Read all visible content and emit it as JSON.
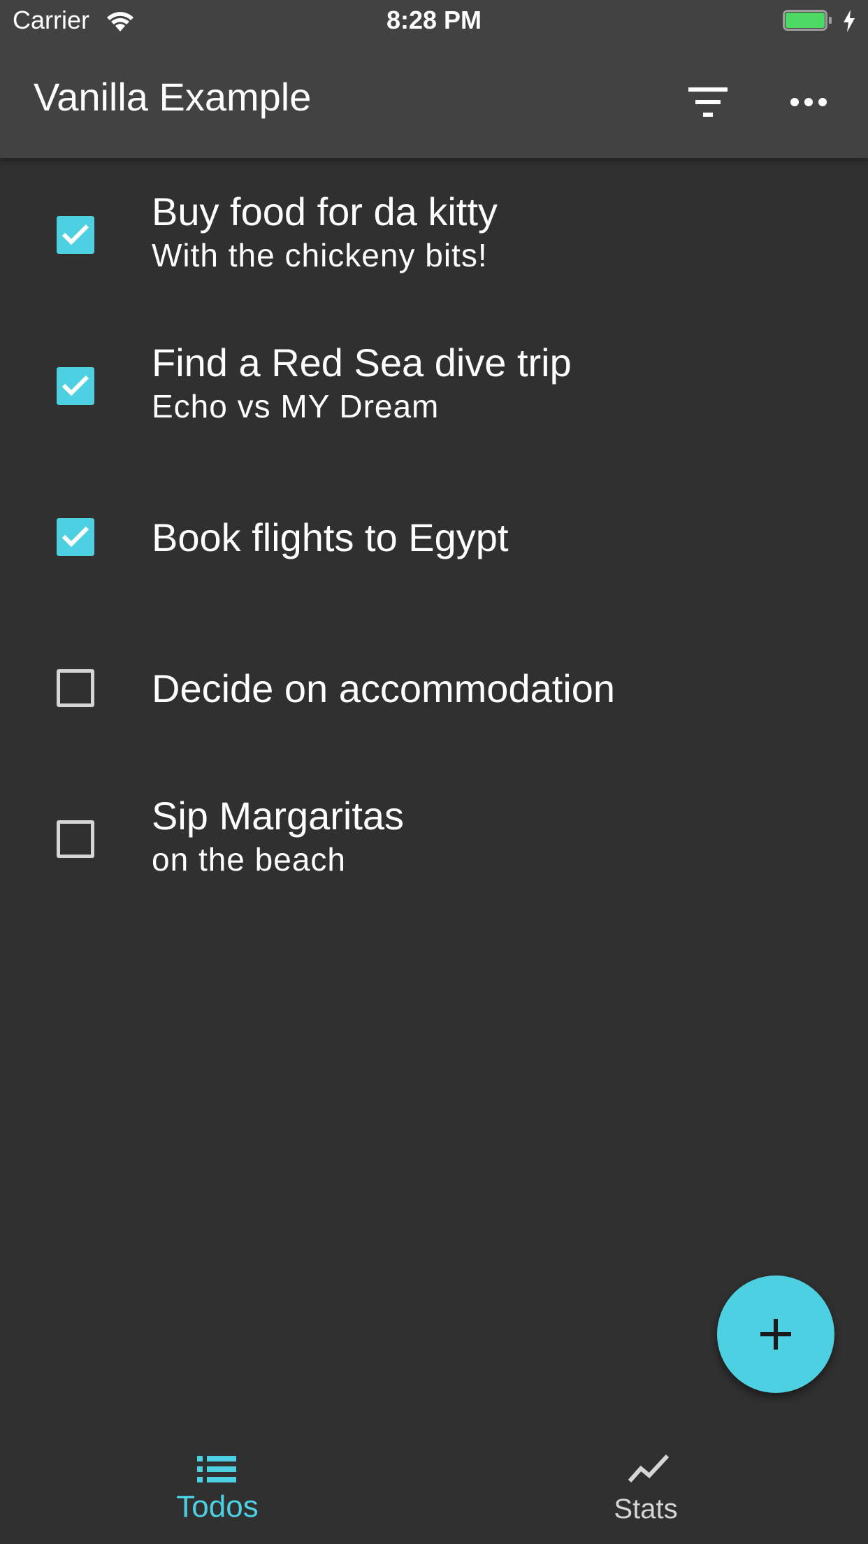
{
  "status_bar": {
    "carrier": "Carrier",
    "time": "8:28 PM",
    "battery_level": 1.0
  },
  "app_bar": {
    "title": "Vanilla Example",
    "filter_icon": "filter-list-icon",
    "more_icon": "more-horiz-icon"
  },
  "todos": [
    {
      "title": "Buy food for da kitty",
      "note": "With the chickeny bits!",
      "completed": true
    },
    {
      "title": "Find a Red Sea dive trip",
      "note": "Echo vs MY Dream",
      "completed": true
    },
    {
      "title": "Book flights to Egypt",
      "note": "",
      "completed": true
    },
    {
      "title": "Decide on accommodation",
      "note": "",
      "completed": false
    },
    {
      "title": "Sip Margaritas",
      "note": "on the beach",
      "completed": false
    }
  ],
  "fab": {
    "icon": "add-icon"
  },
  "bottom_nav": {
    "items": [
      {
        "label": "Todos",
        "icon": "list-icon",
        "active": true
      },
      {
        "label": "Stats",
        "icon": "show-chart-icon",
        "active": false
      }
    ]
  },
  "colors": {
    "accent": "#4dd0e1",
    "background": "#303030",
    "app_bar": "#424242",
    "battery": "#4cd964"
  }
}
